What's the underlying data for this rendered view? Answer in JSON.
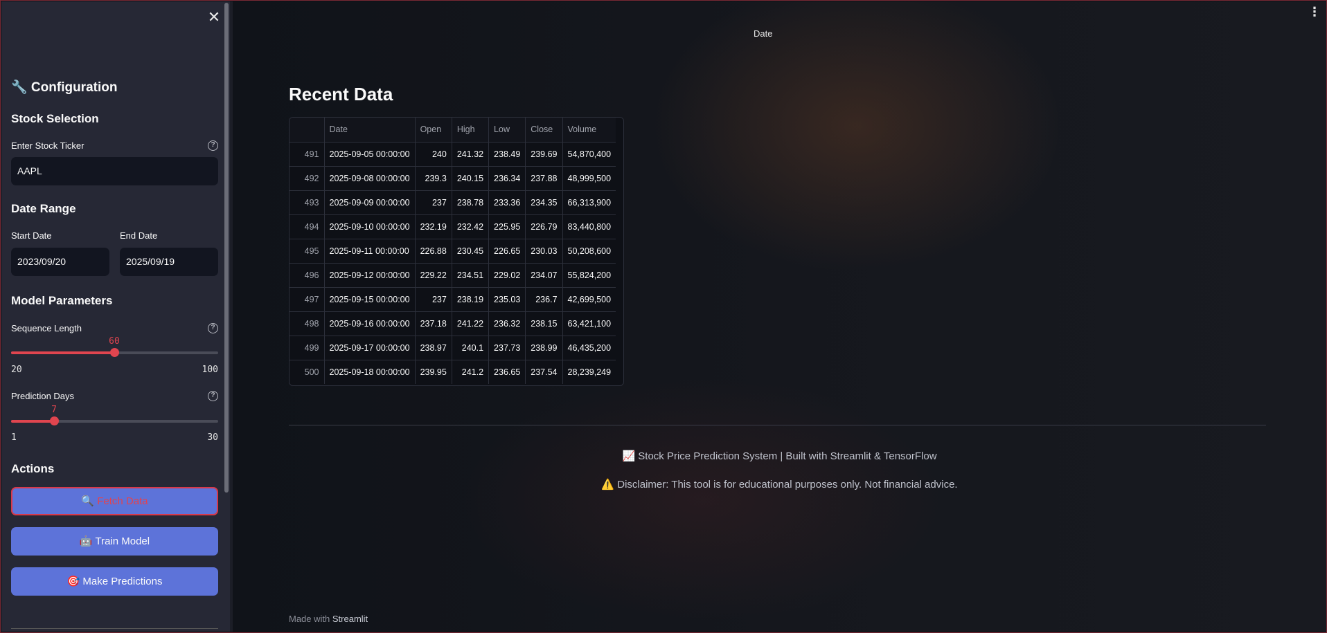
{
  "sidebar": {
    "title": "🔧 Configuration",
    "stock_section": "Stock Selection",
    "ticker_label": "Enter Stock Ticker",
    "ticker_value": "AAPL",
    "date_section": "Date Range",
    "start_label": "Start Date",
    "start_value": "2023/09/20",
    "end_label": "End Date",
    "end_value": "2025/09/19",
    "model_section": "Model Parameters",
    "seq_label": "Sequence Length",
    "seq_value": "60",
    "seq_min": "20",
    "seq_max": "100",
    "pred_label": "Prediction Days",
    "pred_value": "7",
    "pred_min": "1",
    "pred_max": "30",
    "actions_section": "Actions",
    "fetch_label": "🔍 Fetch Data",
    "train_label": "🤖 Train Model",
    "predict_label": "🎯 Make Predictions",
    "help_glyph": "?",
    "close_glyph": "✕"
  },
  "main": {
    "top_label": "Date",
    "section_title": "Recent Data",
    "table": {
      "headers": [
        "",
        "Date",
        "Open",
        "High",
        "Low",
        "Close",
        "Volume"
      ],
      "rows": [
        [
          "491",
          "2025-09-05 00:00:00",
          "240",
          "241.32",
          "238.49",
          "239.69",
          "54,870,400"
        ],
        [
          "492",
          "2025-09-08 00:00:00",
          "239.3",
          "240.15",
          "236.34",
          "237.88",
          "48,999,500"
        ],
        [
          "493",
          "2025-09-09 00:00:00",
          "237",
          "238.78",
          "233.36",
          "234.35",
          "66,313,900"
        ],
        [
          "494",
          "2025-09-10 00:00:00",
          "232.19",
          "232.42",
          "225.95",
          "226.79",
          "83,440,800"
        ],
        [
          "495",
          "2025-09-11 00:00:00",
          "226.88",
          "230.45",
          "226.65",
          "230.03",
          "50,208,600"
        ],
        [
          "496",
          "2025-09-12 00:00:00",
          "229.22",
          "234.51",
          "229.02",
          "234.07",
          "55,824,200"
        ],
        [
          "497",
          "2025-09-15 00:00:00",
          "237",
          "238.19",
          "235.03",
          "236.7",
          "42,699,500"
        ],
        [
          "498",
          "2025-09-16 00:00:00",
          "237.18",
          "241.22",
          "236.32",
          "238.15",
          "63,421,100"
        ],
        [
          "499",
          "2025-09-17 00:00:00",
          "238.97",
          "240.1",
          "237.73",
          "238.99",
          "46,435,200"
        ],
        [
          "500",
          "2025-09-18 00:00:00",
          "239.95",
          "241.2",
          "236.65",
          "237.54",
          "28,239,249"
        ]
      ]
    },
    "footer_title": "📈 Stock Price Prediction System | Built with Streamlit & TensorFlow",
    "footer_disclaimer": "⚠️ Disclaimer: This tool is for educational purposes only. Not financial advice.",
    "made_with_prefix": "Made with",
    "made_with_brand": "Streamlit",
    "menu_glyph": "⋮"
  },
  "colors": {
    "accent": "#5d73d9",
    "slider": "#e0454f",
    "sidebar_bg": "#262835",
    "main_bg": "#0e1117"
  }
}
